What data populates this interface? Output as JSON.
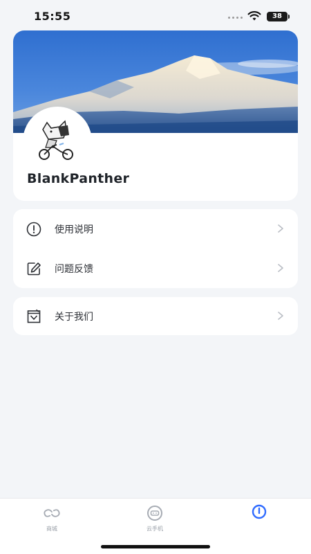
{
  "status_bar": {
    "time": "15:55",
    "battery": "38"
  },
  "profile": {
    "username": "BlankPanther",
    "banner_image": "snow-mountain-landscape",
    "avatar_image": "bicycle-cat-illustration"
  },
  "menu_group_1": [
    {
      "label": "使用说明",
      "icon": "info-circle-icon"
    },
    {
      "label": "问题反馈",
      "icon": "edit-icon"
    }
  ],
  "menu_group_2": [
    {
      "label": "关于我们",
      "icon": "about-icon"
    }
  ],
  "tabbar": {
    "tabs": [
      {
        "label": "商城",
        "icon": "link-icon"
      },
      {
        "label": "云手机",
        "icon": "cloud-phone-icon"
      },
      {
        "label": "",
        "icon": "profile-icon",
        "active": true
      }
    ]
  },
  "colors": {
    "accent": "#2f6bff",
    "background": "#f3f5f8",
    "card": "#ffffff"
  }
}
